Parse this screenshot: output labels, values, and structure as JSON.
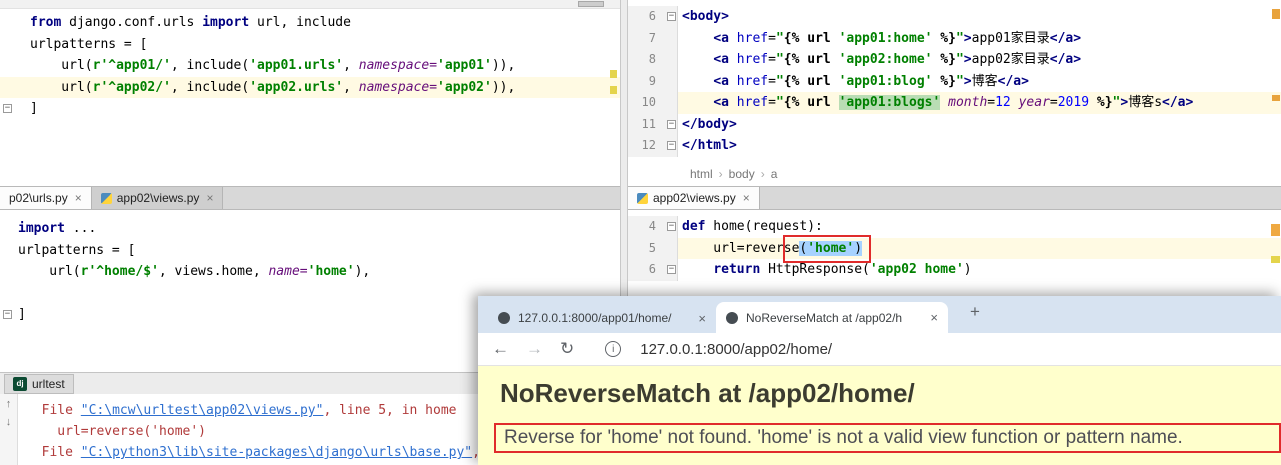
{
  "glyphs": {
    "close": "×",
    "plus": "+"
  },
  "tabs": {
    "left": [
      {
        "label": "p02\\urls.py"
      },
      {
        "label": "app02\\views.py"
      }
    ],
    "right": [
      {
        "label": "app02\\views.py"
      }
    ]
  },
  "run_tab": {
    "label": "urltest",
    "icon_text": "dj"
  },
  "breadcrumb": {
    "items": [
      "html",
      "body",
      "a"
    ]
  },
  "console_nav": {
    "up": "↑",
    "down": "↓"
  },
  "panes": {
    "top_left": {
      "lines": [
        {
          "tokens": [
            {
              "t": "kw",
              "v": "from"
            },
            {
              "t": "p",
              "v": " django.conf.urls "
            },
            {
              "t": "kw",
              "v": "import"
            },
            {
              "t": "p",
              "v": " url, include"
            }
          ]
        },
        {
          "tokens": [
            {
              "t": "p",
              "v": "urlpatterns = ["
            }
          ]
        },
        {
          "tokens": [
            {
              "t": "p",
              "v": "    url("
            },
            {
              "t": "s",
              "v": "r'^app01/'"
            },
            {
              "t": "p",
              "v": ", include("
            },
            {
              "t": "s",
              "v": "'app01.urls'"
            },
            {
              "t": "p",
              "v": ", "
            },
            {
              "t": "param",
              "v": "namespace="
            },
            {
              "t": "s",
              "v": "'app01'"
            },
            {
              "t": "p",
              "v": ")),"
            }
          ]
        },
        {
          "hl": true,
          "tokens": [
            {
              "t": "p",
              "v": "    url("
            },
            {
              "t": "s",
              "v": "r'^app02/'"
            },
            {
              "t": "p",
              "v": ", include("
            },
            {
              "t": "s",
              "v": "'app02.urls'"
            },
            {
              "t": "p",
              "v": ", "
            },
            {
              "t": "param",
              "v": "namespace="
            },
            {
              "t": "s",
              "v": "'app02'"
            },
            {
              "t": "p",
              "v": ")),"
            }
          ]
        },
        {
          "fold": true,
          "tokens": [
            {
              "t": "p",
              "v": "]"
            }
          ]
        }
      ]
    },
    "top_right": {
      "line_numbers": [
        "6",
        "7",
        "8",
        "9",
        "10",
        "11",
        "12"
      ],
      "lines": [
        {
          "fold": true,
          "tokens": [
            {
              "t": "tag",
              "v": "<body>"
            }
          ]
        },
        {
          "tokens": [
            {
              "t": "p",
              "v": "    "
            },
            {
              "t": "tag",
              "v": "<a "
            },
            {
              "t": "attr",
              "v": "href"
            },
            {
              "t": "p",
              "v": "="
            },
            {
              "t": "s",
              "v": "\""
            },
            {
              "t": "tmpl",
              "v": "{% url "
            },
            {
              "t": "s",
              "v": "'app01:home'"
            },
            {
              "t": "tmpl",
              "v": " %}"
            },
            {
              "t": "s",
              "v": "\""
            },
            {
              "t": "tag",
              "v": ">"
            },
            {
              "t": "p",
              "v": "app01家目录"
            },
            {
              "t": "tag",
              "v": "</a>"
            }
          ]
        },
        {
          "tokens": [
            {
              "t": "p",
              "v": "    "
            },
            {
              "t": "tag",
              "v": "<a "
            },
            {
              "t": "attr",
              "v": "href"
            },
            {
              "t": "p",
              "v": "="
            },
            {
              "t": "s",
              "v": "\""
            },
            {
              "t": "tmpl",
              "v": "{% url "
            },
            {
              "t": "s",
              "v": "'app02:home'"
            },
            {
              "t": "tmpl",
              "v": " %}"
            },
            {
              "t": "s",
              "v": "\""
            },
            {
              "t": "tag",
              "v": ">"
            },
            {
              "t": "p",
              "v": "app02家目录"
            },
            {
              "t": "tag",
              "v": "</a>"
            }
          ]
        },
        {
          "tokens": [
            {
              "t": "p",
              "v": "    "
            },
            {
              "t": "tag",
              "v": "<a "
            },
            {
              "t": "attr",
              "v": "href"
            },
            {
              "t": "p",
              "v": "="
            },
            {
              "t": "s",
              "v": "\""
            },
            {
              "t": "tmpl",
              "v": "{% url "
            },
            {
              "t": "s",
              "v": "'app01:blog'"
            },
            {
              "t": "tmpl",
              "v": " %}"
            },
            {
              "t": "s",
              "v": "\""
            },
            {
              "t": "tag",
              "v": ">"
            },
            {
              "t": "p",
              "v": "博客"
            },
            {
              "t": "tag",
              "v": "</a>"
            }
          ]
        },
        {
          "hl": true,
          "tokens": [
            {
              "t": "p",
              "v": "    "
            },
            {
              "t": "tag",
              "v": "<a "
            },
            {
              "t": "attr",
              "v": "href"
            },
            {
              "t": "p",
              "v": "="
            },
            {
              "t": "s",
              "v": "\""
            },
            {
              "t": "tmpl",
              "v": "{% url "
            },
            {
              "t": "s",
              "v": "'app01:blogs'",
              "bg": "g"
            },
            {
              "t": "p",
              "v": " "
            },
            {
              "t": "param",
              "v": "month"
            },
            {
              "t": "p",
              "v": "="
            },
            {
              "t": "num",
              "v": "12"
            },
            {
              "t": "p",
              "v": " "
            },
            {
              "t": "param",
              "v": "year"
            },
            {
              "t": "p",
              "v": "="
            },
            {
              "t": "num",
              "v": "2019"
            },
            {
              "t": "tmpl",
              "v": " %}"
            },
            {
              "t": "s",
              "v": "\""
            },
            {
              "t": "tag",
              "v": ">"
            },
            {
              "t": "p",
              "v": "博客s"
            },
            {
              "t": "tag",
              "v": "</a>"
            }
          ]
        },
        {
          "fold": true,
          "tokens": [
            {
              "t": "tag",
              "v": "</body>"
            }
          ]
        },
        {
          "fold": true,
          "tokens": [
            {
              "t": "tag",
              "v": "</html>"
            }
          ]
        }
      ]
    },
    "mid_left": {
      "lines": [
        {
          "tokens": [
            {
              "t": "kw",
              "v": "import"
            },
            {
              "t": "p",
              "v": " ..."
            }
          ]
        },
        {
          "tokens": [
            {
              "t": "p",
              "v": "urlpatterns = ["
            }
          ]
        },
        {
          "tokens": [
            {
              "t": "p",
              "v": "    url("
            },
            {
              "t": "s",
              "v": "r'^home/$'"
            },
            {
              "t": "p",
              "v": ", views.home, "
            },
            {
              "t": "param",
              "v": "name="
            },
            {
              "t": "s",
              "v": "'home'"
            },
            {
              "t": "p",
              "v": "),"
            }
          ]
        },
        {
          "tokens": []
        },
        {
          "fold": true,
          "tokens": [
            {
              "t": "p",
              "v": "]"
            }
          ]
        }
      ]
    },
    "mid_right": {
      "line_numbers": [
        "4",
        "5",
        "6"
      ],
      "lines": [
        {
          "fold": true,
          "tokens": [
            {
              "t": "kw",
              "v": "def"
            },
            {
              "t": "p",
              "v": " home(request):"
            }
          ]
        },
        {
          "hl": true,
          "tokens": [
            {
              "t": "p",
              "v": "    url=reverse"
            },
            {
              "t": "p",
              "v": "(",
              "bg": "b"
            },
            {
              "t": "s",
              "v": "'home'",
              "bg": "b"
            },
            {
              "t": "p",
              "v": ")",
              "bg": "b"
            }
          ]
        },
        {
          "fold": true,
          "tokens": [
            {
              "t": "p",
              "v": "    "
            },
            {
              "t": "kw",
              "v": "return"
            },
            {
              "t": "p",
              "v": " HttpResponse("
            },
            {
              "t": "s",
              "v": "'app02 home'"
            },
            {
              "t": "p",
              "v": ")"
            }
          ]
        }
      ]
    },
    "console": {
      "lines": [
        {
          "tokens": [
            {
              "t": "err",
              "v": "  File "
            },
            {
              "t": "link",
              "v": "\"C:\\mcw\\urltest\\app02\\views.py\""
            },
            {
              "t": "err",
              "v": ", line 5, in home"
            }
          ]
        },
        {
          "tokens": [
            {
              "t": "err",
              "v": "    url=reverse('home')"
            }
          ]
        },
        {
          "tokens": [
            {
              "t": "err",
              "v": "  File "
            },
            {
              "t": "link",
              "v": "\"C:\\python3\\lib\\site-packages\\django\\urls\\base.py\""
            },
            {
              "t": "err",
              "v": ", line"
            }
          ]
        }
      ]
    }
  },
  "browser": {
    "tabs": [
      {
        "title": "127.0.0.1:8000/app01/home/"
      },
      {
        "title": "NoReverseMatch at /app02/h"
      }
    ],
    "url": "127.0.0.1:8000/app02/home/",
    "nav": {
      "back": "←",
      "forward": "→",
      "reload": "↻",
      "info": "i"
    },
    "page": {
      "title": "NoReverseMatch at /app02/home/",
      "message": "Reverse for 'home' not found. 'home' is not a valid view function or pattern name."
    }
  }
}
